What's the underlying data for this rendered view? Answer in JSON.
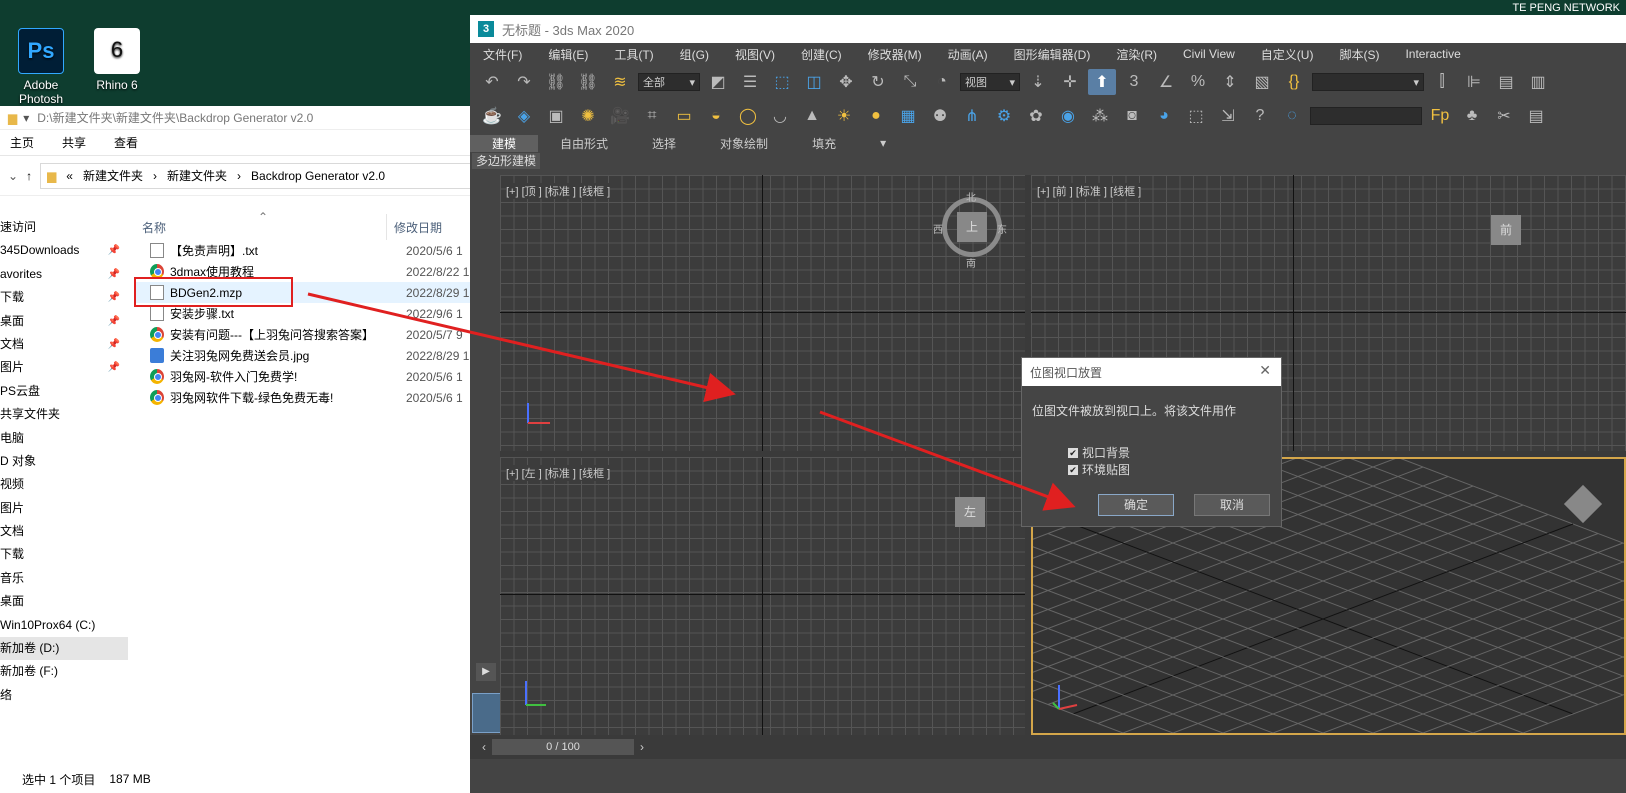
{
  "desktop": {
    "icons": [
      {
        "label": "Adobe Photosh",
        "glyph": "Ps"
      },
      {
        "label": "Rhino 6",
        "glyph": "6"
      }
    ],
    "brand_text": "TE PENG NETWORK"
  },
  "explorer": {
    "path_title": "D:\\新建文件夹\\新建文件夹\\Backdrop Generator v2.0",
    "ribbon_tabs": [
      "主页",
      "共享",
      "查看"
    ],
    "breadcrumb": [
      "«",
      "新建文件夹",
      "新建文件夹",
      "Backdrop Generator v2.0"
    ],
    "nav_items": [
      {
        "label": "速访问"
      },
      {
        "label": "345Downloads",
        "pinned": true
      },
      {
        "label": "avorites",
        "pinned": true
      },
      {
        "label": "下载",
        "pinned": true
      },
      {
        "label": "桌面",
        "pinned": true
      },
      {
        "label": "文档",
        "pinned": true
      },
      {
        "label": "图片",
        "pinned": true
      },
      {
        "label": "PS云盘"
      },
      {
        "label": "共享文件夹"
      },
      {
        "label": "电脑"
      },
      {
        "label": "D 对象"
      },
      {
        "label": "视频"
      },
      {
        "label": "图片"
      },
      {
        "label": "文档"
      },
      {
        "label": "下载"
      },
      {
        "label": "音乐"
      },
      {
        "label": "桌面"
      },
      {
        "label": "Win10Prox64 (C:)"
      },
      {
        "label": "新加卷 (D:)",
        "selected": true
      },
      {
        "label": "新加卷 (F:)"
      },
      {
        "label": "络"
      }
    ],
    "columns": {
      "name": "名称",
      "date": "修改日期"
    },
    "files": [
      {
        "name": "【免责声明】.txt",
        "date": "2020/5/6 1",
        "icon": "doc"
      },
      {
        "name": "3dmax使用教程",
        "date": "2022/8/22 1",
        "icon": "chrome"
      },
      {
        "name": "BDGen2.mzp",
        "date": "2022/8/29 1",
        "icon": "doc",
        "selected": true
      },
      {
        "name": "安装步骤.txt",
        "date": "2022/9/6 1",
        "icon": "doc"
      },
      {
        "name": "安装有问题---【上羽兔问答搜索答案】",
        "date": "2020/5/7 9",
        "icon": "chrome"
      },
      {
        "name": "关注羽兔网免费送会员.jpg",
        "date": "2022/8/29 1",
        "icon": "img"
      },
      {
        "name": "羽兔网-软件入门免费学!",
        "date": "2020/5/6 1",
        "icon": "chrome"
      },
      {
        "name": "羽兔网软件下载-绿色免费无毒!",
        "date": "2020/5/6 1",
        "icon": "chrome"
      }
    ],
    "status": {
      "selected": "选中 1 个项目",
      "size": "187 MB"
    }
  },
  "max": {
    "title": "无标题 - 3ds Max 2020",
    "logo_glyph": "3",
    "menu": [
      "文件(F)",
      "编辑(E)",
      "工具(T)",
      "组(G)",
      "视图(V)",
      "创建(C)",
      "修改器(M)",
      "动画(A)",
      "图形编辑器(D)",
      "渲染(R)",
      "Civil View",
      "自定义(U)",
      "脚本(S)",
      "Interactive"
    ],
    "selection_filter": "全部",
    "ref_coord": "视图",
    "ribbon_tabs": [
      "建模",
      "自由形式",
      "选择",
      "对象绘制",
      "填充"
    ],
    "ribbon_subtab": "多边形建模",
    "viewports": {
      "top": {
        "label": "[+] [顶 ] [标准 ] [线框 ]",
        "cube": "上",
        "compass": [
          "北",
          "西",
          "东",
          "南"
        ]
      },
      "front": {
        "label": "[+] [前 ] [标准 ] [线框 ]",
        "cube": "前"
      },
      "left": {
        "label": "[+] [左 ] [标准 ] [线框 ]",
        "cube": "左"
      }
    },
    "time_slider": "0 / 100"
  },
  "dialog": {
    "title": "位图视口放置",
    "message": "位图文件被放到视口上。将该文件用作",
    "options": [
      {
        "label": "视口背景",
        "checked": true
      },
      {
        "label": "环境贴图",
        "checked": true
      }
    ],
    "ok": "确定",
    "cancel": "取消"
  },
  "colors": {
    "annotation": "#e02020",
    "max_bg": "#444444",
    "desktop": "#0e3d2f"
  }
}
